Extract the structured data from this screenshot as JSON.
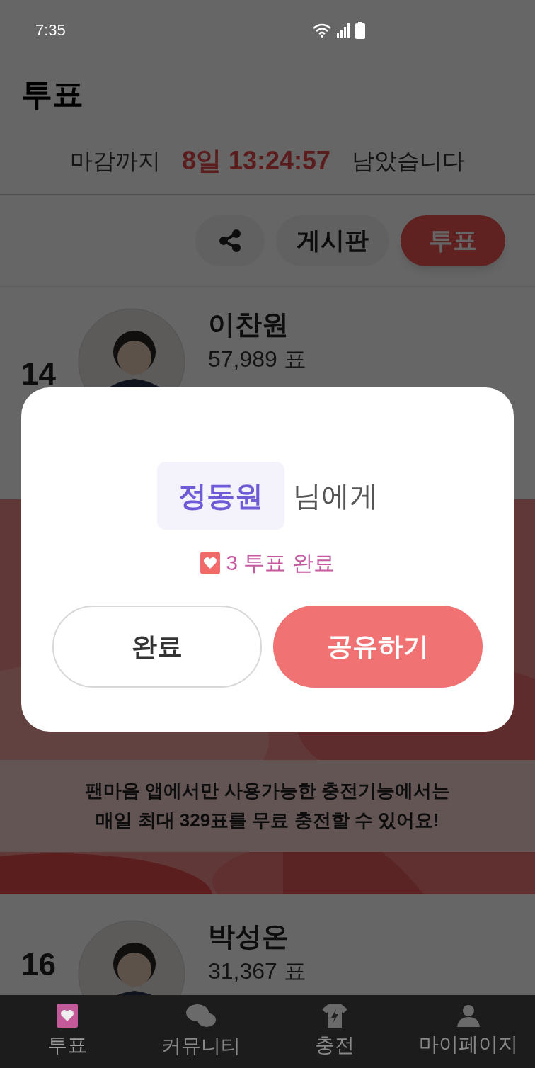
{
  "status_bar": {
    "time": "7:35"
  },
  "header": {
    "title": "투표"
  },
  "countdown": {
    "prefix": "마감까지",
    "remaining": "8일 13:24:57",
    "suffix": "남았습니다"
  },
  "row_actions": {
    "board": "게시판",
    "vote": "투표"
  },
  "rows": [
    {
      "rank": "14",
      "name": "이찬원",
      "votes": "57,989 표"
    }
  ],
  "banner": {
    "lines": [
      "팬마음 앱에서만 사용가능한 충전기능에서는",
      "매일 최대 329표를 무료 충전할 수 있어요!"
    ]
  },
  "bottom_row": {
    "rank": "16",
    "name": "박성온",
    "votes": "31,367 표"
  },
  "dialog": {
    "recipient": "정동원",
    "recipient_suffix": "님에게",
    "result": "3 투표 완료",
    "buttons": [
      {
        "label": "완료",
        "kind": "secondary"
      },
      {
        "label": "공유하기",
        "kind": "primary"
      }
    ]
  },
  "nav": [
    {
      "label": "투표",
      "kind": "vote",
      "selected": true
    },
    {
      "label": "커뮤니티",
      "kind": "community",
      "selected": false
    },
    {
      "label": "충전",
      "kind": "charge",
      "selected": false
    },
    {
      "label": "마이페이지",
      "kind": "mypage",
      "selected": false
    }
  ]
}
